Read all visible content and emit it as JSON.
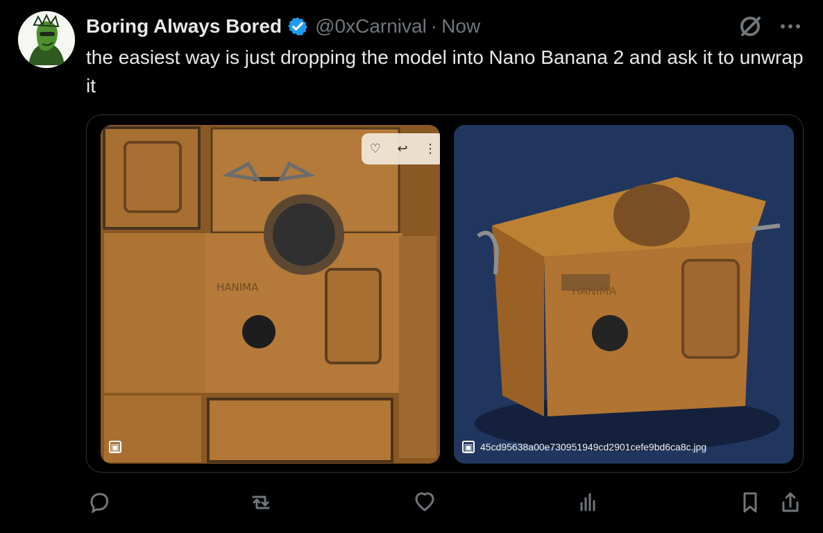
{
  "tweet": {
    "display_name": "Boring Always Bored",
    "handle": "@0xCarnival",
    "separator": "·",
    "time": "Now",
    "text": "the easiest way is just dropping the model into Nano Banana 2 and ask it to unwrap it",
    "verified": true
  },
  "media": {
    "image_1": {
      "badge_icon": "image-icon",
      "caption": ""
    },
    "image_2": {
      "badge_icon": "image-icon",
      "caption": "45cd95638a00e730951949cd2901cefe9bd6ca8c.jpg"
    },
    "hover_actions": [
      "heart-icon",
      "reply-icon",
      "more-vertical-icon"
    ],
    "embedded_text": "HANIMA"
  },
  "actions": [
    "reply-icon",
    "retweet-icon",
    "like-icon",
    "views-icon",
    "bookmark-icon",
    "share-icon"
  ],
  "colors": {
    "background": "#000000",
    "text": "#e7e9ea",
    "muted": "#71767b",
    "verified": "#1d9bf0",
    "orange": "#b77d36"
  }
}
